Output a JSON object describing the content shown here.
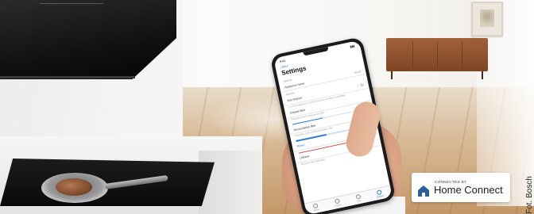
{
  "photo": {
    "credit": "Fot. Bosch"
  },
  "badge": {
    "small_label": "CONNECTED BY",
    "brand": "Home Connect",
    "icon": "home-connect-house-icon"
  },
  "phone": {
    "status_time": "9:41",
    "status_icons": "▮▮▮",
    "back_label": "‹ Back",
    "title": "Settings",
    "general_label": "General",
    "appliance_name_label": "Appliance name",
    "appliance_name_value": "Hood",
    "security_label": "Security",
    "rows": [
      {
        "label": "Key lockout",
        "hint": "Lock the appliance so that it can't be operated accidentally."
      },
      {
        "label": "Grease filter",
        "hint": "Saturation level of the grease filter"
      },
      {
        "label": "Recirculation filter",
        "hint": "Saturation level of the recirculation filter"
      },
      {
        "label": "Reset"
      },
      {
        "label": "Lifetime",
        "hint": "Reset the filter saturation"
      }
    ],
    "tabs": [
      "Home",
      "Control",
      "Info",
      "Settings"
    ]
  },
  "colors": {
    "accent": "#2b7bd8",
    "hood": "#111111",
    "sideboard": "#8a4b28"
  }
}
